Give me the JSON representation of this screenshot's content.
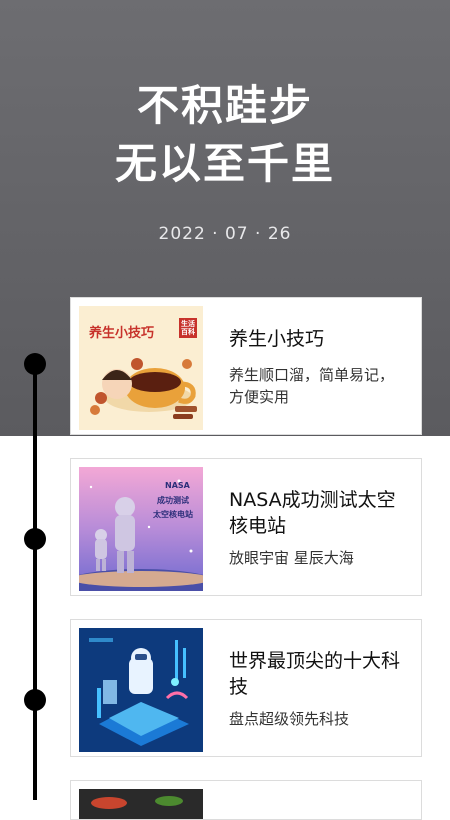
{
  "hero": {
    "title_line1": "不积跬步",
    "title_line2": "无以至千里",
    "date": "2022 · 07 · 26"
  },
  "articles": [
    {
      "title": "养生小技巧",
      "subtitle": "养生顺口溜，简单易记，方便实用",
      "thumb_title": "养生小技巧",
      "thumb_badge": "生活百科"
    },
    {
      "title": "NASA成功测试太空核电站",
      "subtitle": "放眼宇宙 星辰大海",
      "thumb_line1": "NASA",
      "thumb_line2": "成功测试",
      "thumb_line3": "太空核电站"
    },
    {
      "title": "世界最顶尖的十大科技",
      "subtitle": "盘点超级领先科技"
    }
  ],
  "colors": {
    "hero_bg": "#6d6d71",
    "timeline": "#000000",
    "card_border": "#dcdcdc"
  }
}
